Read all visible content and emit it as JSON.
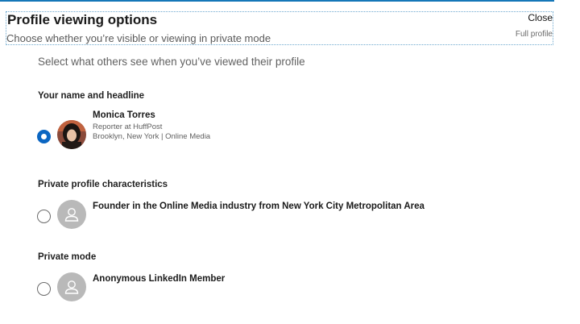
{
  "header": {
    "title": "Profile viewing options",
    "subtitle": "Choose whether you’re visible or viewing in private mode",
    "close_label": "Close",
    "full_profile_label": "Full profile"
  },
  "intro": "Select what others see when you’ve viewed their profile",
  "options": [
    {
      "section": "Your name and headline",
      "selected": true,
      "name": "Monica Torres",
      "headline": "Reporter at HuffPost",
      "location": "Brooklyn, New York | Online Media",
      "avatar": "profile-photo"
    },
    {
      "section": "Private profile characteristics",
      "selected": false,
      "name": "Founder in the Online Media industry from New York City Metropolitan Area",
      "avatar": "person-icon"
    },
    {
      "section": "Private mode",
      "selected": false,
      "name": "Anonymous LinkedIn Member",
      "avatar": "person-icon"
    }
  ],
  "colors": {
    "accent": "#0b66c2",
    "top_bar": "#1577b8",
    "ghost_avatar": "#b9b9b9"
  }
}
